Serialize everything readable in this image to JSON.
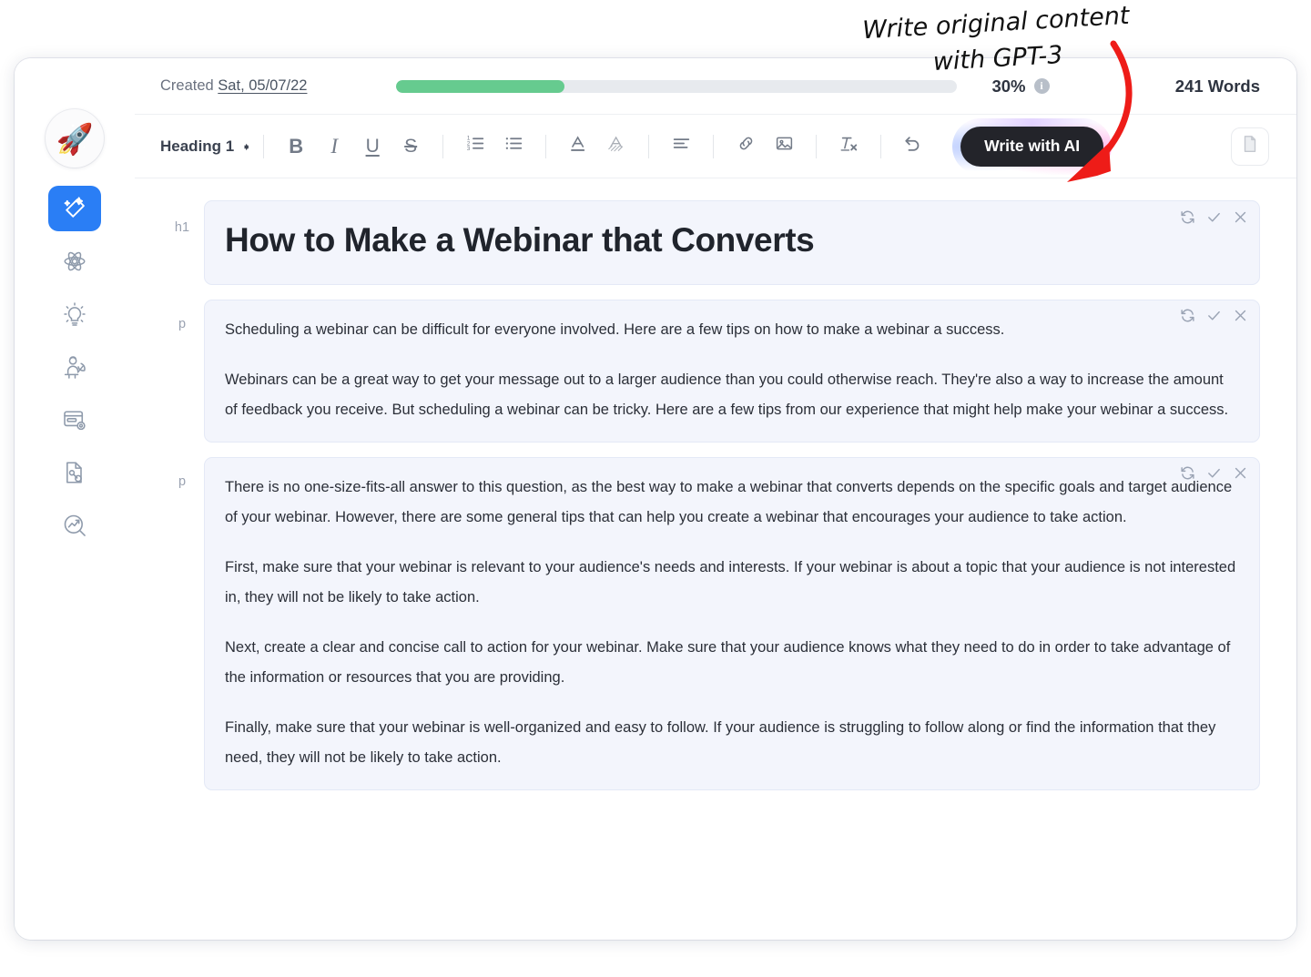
{
  "annotation": {
    "text": "Write original content\nwith GPT-3",
    "arrow_color": "#ee1c18"
  },
  "sidebar": {
    "logo_icon": "rocket-emoji",
    "logo_glyph": "🚀",
    "items": [
      {
        "name": "magic-write-tool",
        "icon": "magic-pen-icon",
        "active": true
      },
      {
        "name": "ai-atom-tool",
        "icon": "atom-icon",
        "active": false
      },
      {
        "name": "ideas-tool",
        "icon": "lightbulb-icon",
        "active": false
      },
      {
        "name": "writer-tool",
        "icon": "writer-person-icon",
        "active": false
      },
      {
        "name": "templates-tool",
        "icon": "card-settings-icon",
        "active": false
      },
      {
        "name": "document-keywords-tool",
        "icon": "document-key-icon",
        "active": false
      },
      {
        "name": "analytics-tool",
        "icon": "chart-search-icon",
        "active": false
      }
    ]
  },
  "meta": {
    "created_label": "Created",
    "created_date": "Sat, 05/07/22",
    "progress_percent": 30,
    "progress_label": "30%",
    "progress_color": "#66cb8f",
    "info_glyph": "i",
    "word_count_label": "241 Words"
  },
  "toolbar": {
    "style_select": "Heading 1",
    "buttons": [
      {
        "name": "bold-button",
        "icon": "bold-icon",
        "glyph": "B",
        "class": "bold"
      },
      {
        "name": "italic-button",
        "icon": "italic-icon",
        "glyph": "I",
        "class": "italic"
      },
      {
        "name": "underline-button",
        "icon": "underline-icon",
        "glyph": "U",
        "class": "under"
      },
      {
        "name": "strikethrough-button",
        "icon": "strikethrough-icon",
        "glyph": "S",
        "class": "strike"
      }
    ],
    "ai_button_label": "Write with AI",
    "ai_button_color": "#23242a",
    "icon_buttons": [
      "ordered-list-icon",
      "bullet-list-icon",
      "text-color-icon",
      "highlight-color-icon",
      "align-left-icon",
      "link-icon",
      "image-icon",
      "clear-format-icon",
      "undo-icon"
    ],
    "export_icon": "document-export-icon"
  },
  "editor": {
    "blocks": [
      {
        "tag": "h1",
        "type": "heading",
        "text": "How to Make a Webinar that Converts",
        "actions": [
          "regenerate-icon",
          "accept-icon",
          "dismiss-icon"
        ]
      },
      {
        "tag": "p",
        "type": "paragraph",
        "paragraphs": [
          "Scheduling a webinar can be difficult for everyone involved. Here are a few tips on how to make a webinar a success.",
          "Webinars can be a great way to get your message out to a larger audience than you could otherwise reach. They're also a way to increase the amount of feedback you receive. But scheduling a webinar can be tricky. Here are a few tips from our experience that might help make your webinar a success."
        ],
        "actions": [
          "regenerate-icon",
          "accept-icon",
          "dismiss-icon"
        ]
      },
      {
        "tag": "p",
        "type": "paragraph",
        "paragraphs": [
          "There is no one-size-fits-all answer to this question, as the best way to make a webinar that converts depends on the specific goals and target audience of your webinar. However, there are some general tips that can help you create a webinar that encourages your audience to take action.",
          "First, make sure that your webinar is relevant to your audience's needs and interests. If your webinar is about a topic that your audience is not interested in, they will not be likely to take action.",
          "Next, create a clear and concise call to action for your webinar. Make sure that your audience knows what they need to do in order to take advantage of the information or resources that you are providing.",
          "Finally, make sure that your webinar is well-organized and easy to follow. If your audience is struggling to follow along or find the information that they need, they will not be likely to take action."
        ],
        "actions": [
          "regenerate-icon",
          "accept-icon",
          "dismiss-icon"
        ]
      }
    ]
  }
}
